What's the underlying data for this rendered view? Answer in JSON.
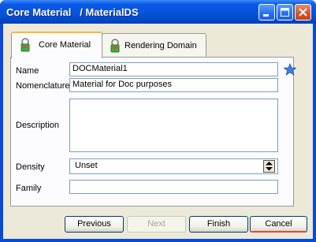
{
  "window": {
    "title": "Core Material   / MaterialDS",
    "controls": {
      "minimize": "minimize-icon",
      "maximize": "maximize-icon",
      "close": "close-icon"
    }
  },
  "tabs": [
    {
      "label": "Core Material",
      "icon": "material-icon",
      "active": true
    },
    {
      "label": "Rendering Domain",
      "icon": "material-icon",
      "active": false
    }
  ],
  "form": {
    "name_label": "Name",
    "name_value": "DOCMaterial1",
    "nomenclature_label": "Nomenclature",
    "nomenclature_value": "Material for Doc purposes",
    "description_label": "Description",
    "description_value": "",
    "density_label": "Density",
    "density_value": "Unset",
    "family_label": "Family",
    "family_value": ""
  },
  "buttons": {
    "previous": "Previous",
    "next": "Next",
    "finish": "Finish",
    "cancel": "Cancel"
  },
  "colors": {
    "titlebar": "#0754dc",
    "client": "#ece9d8",
    "tab_highlight": "#f8b840",
    "star": "#3a7ee8"
  }
}
